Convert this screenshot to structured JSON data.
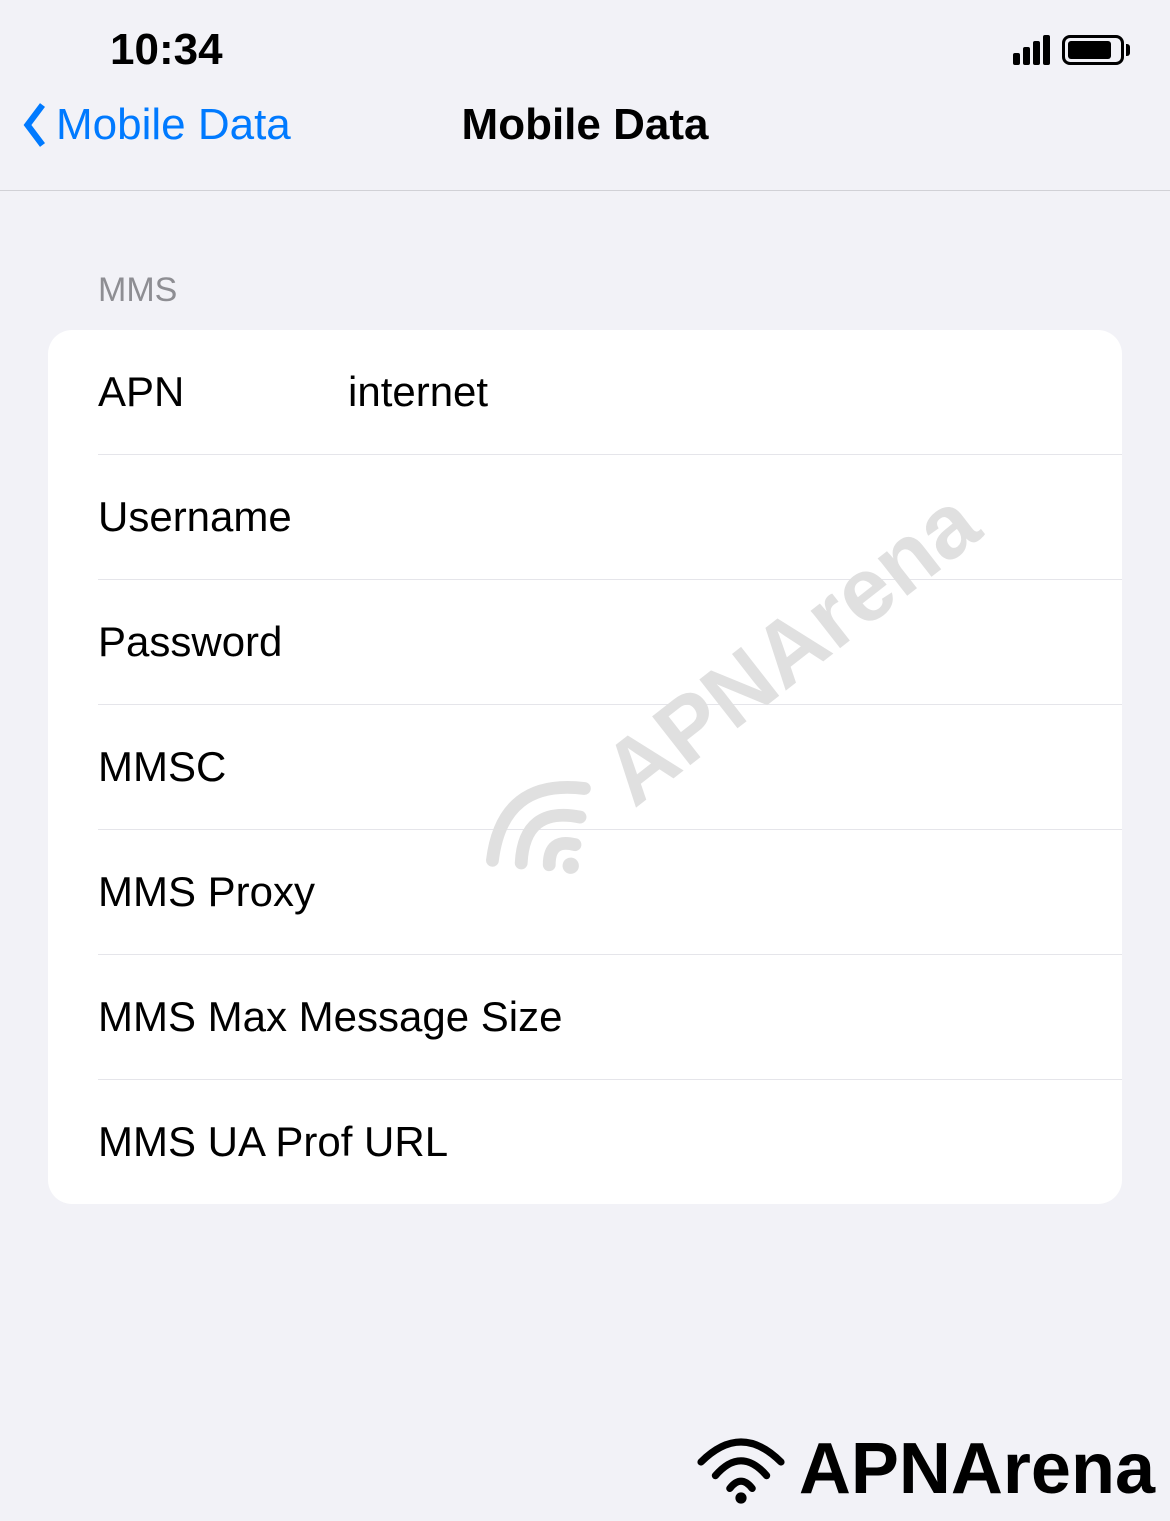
{
  "statusBar": {
    "time": "10:34"
  },
  "navBar": {
    "backLabel": "Mobile Data",
    "title": "Mobile Data"
  },
  "section": {
    "header": "MMS",
    "rows": [
      {
        "label": "APN",
        "value": "internet"
      },
      {
        "label": "Username",
        "value": ""
      },
      {
        "label": "Password",
        "value": ""
      },
      {
        "label": "MMSC",
        "value": ""
      },
      {
        "label": "MMS Proxy",
        "value": ""
      },
      {
        "label": "MMS Max Message Size",
        "value": ""
      },
      {
        "label": "MMS UA Prof URL",
        "value": ""
      }
    ]
  },
  "watermark": {
    "text": "APNArena"
  },
  "footer": {
    "text": "APNArena"
  }
}
